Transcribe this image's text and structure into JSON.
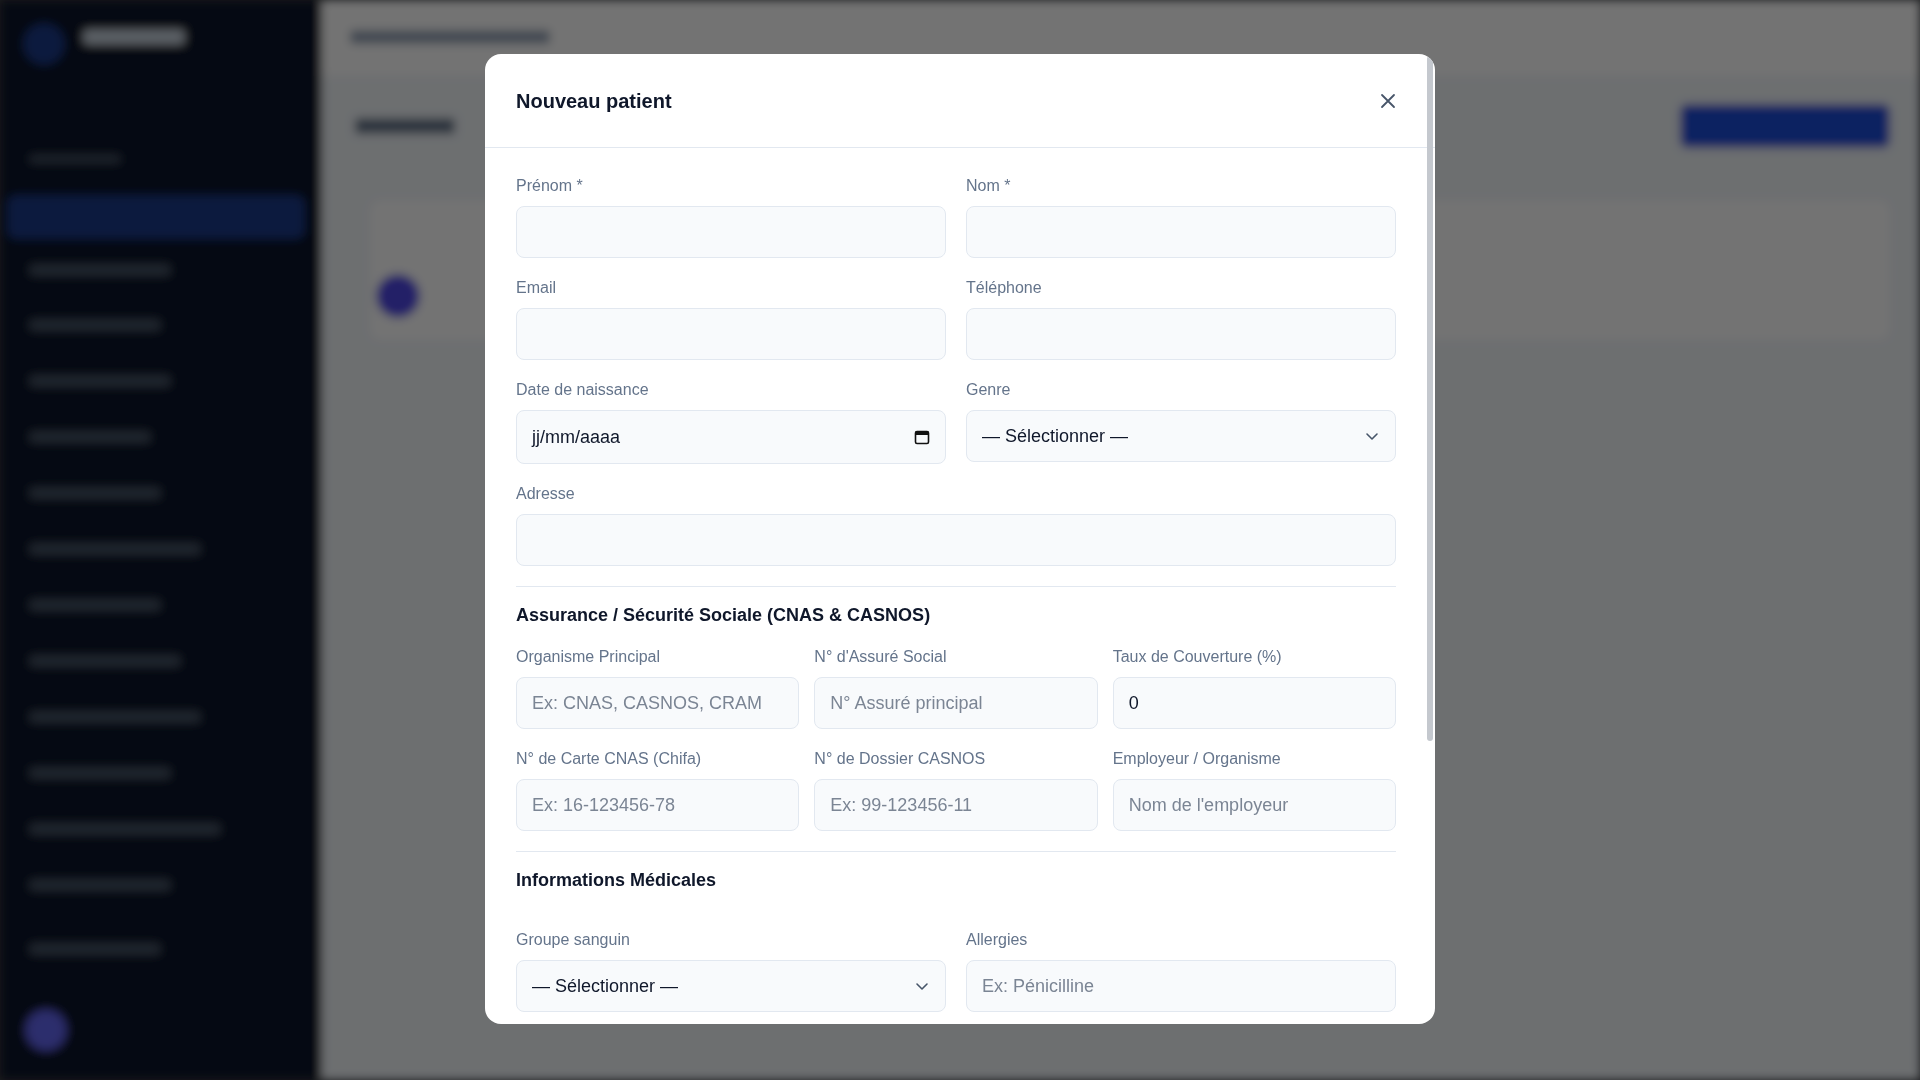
{
  "dialog": {
    "title": "Nouveau patient"
  },
  "identity_rows": [
    [
      {
        "label": "Prénom *",
        "kind": "text"
      },
      {
        "label": "Nom *",
        "kind": "text"
      }
    ],
    [
      {
        "label": "Email",
        "kind": "text"
      },
      {
        "label": "Téléphone",
        "kind": "text"
      }
    ],
    [
      {
        "label": "Date de naissance",
        "kind": "date",
        "value": "jj/mm/aaaa"
      },
      {
        "label": "Genre",
        "kind": "select",
        "value": "— Sélectionner —"
      }
    ],
    [
      {
        "label": "Adresse",
        "kind": "text"
      }
    ]
  ],
  "sections": [
    {
      "heading": "Assurance / Sécurité Sociale (CNAS & CASNOS)",
      "rows": [
        [
          {
            "label": "Organisme Principal",
            "kind": "text",
            "placeholder": "Ex: CNAS, CASNOS, CRAM"
          },
          {
            "label": "N° d'Assuré Social",
            "kind": "text",
            "placeholder": "N° Assuré principal"
          },
          {
            "label": "Taux de Couverture (%)",
            "kind": "text",
            "value": "0"
          }
        ],
        [
          {
            "label": "N° de Carte CNAS (Chifa)",
            "kind": "text",
            "placeholder": "Ex: 16-123456-78"
          },
          {
            "label": "N° de Dossier CASNOS",
            "kind": "text",
            "placeholder": "Ex: 99-123456-11"
          },
          {
            "label": "Employeur / Organisme",
            "kind": "text",
            "placeholder": "Nom de l'employeur"
          }
        ]
      ]
    },
    {
      "heading": "Informations Médicales",
      "rows": [
        [
          {
            "label": "Groupe sanguin",
            "kind": "select",
            "value": "— Sélectionner —"
          },
          {
            "label": "Allergies",
            "kind": "text",
            "placeholder": "Ex: Pénicilline"
          }
        ]
      ]
    }
  ]
}
